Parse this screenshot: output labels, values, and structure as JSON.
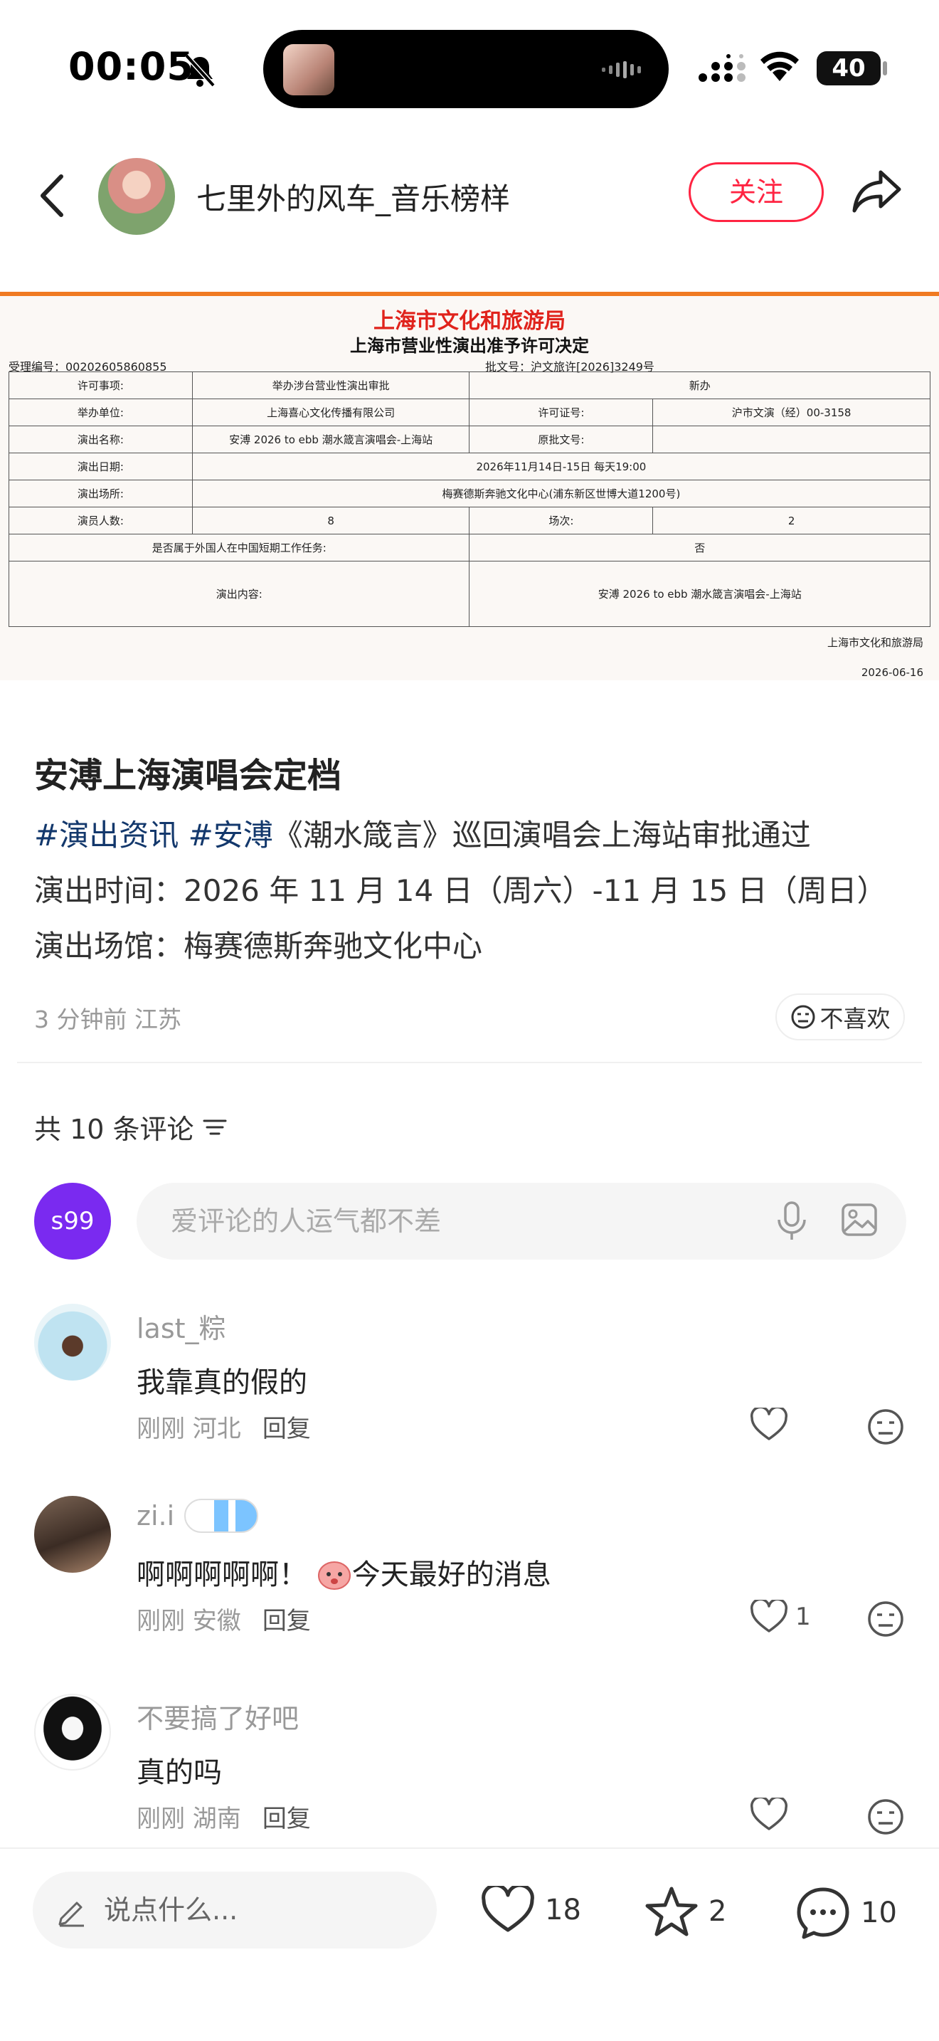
{
  "status_bar": {
    "time": "00:05",
    "battery": "40"
  },
  "header": {
    "author": "七里外的风车_音乐榜样",
    "follow_label": "关注"
  },
  "document": {
    "title_org": "上海市文化和旅游局",
    "title_decision": "上海市营业性演出准予许可决定",
    "receipt_no": "受理编号：00202605860855",
    "approval_no": "批文号：沪文旅许[2026]3249号",
    "rows": {
      "item_label": "许可事项:",
      "item_value": "举办涉台营业性演出审批",
      "item_type": "新办",
      "org_label": "举办单位:",
      "org_value": "上海喜心文化传播有限公司",
      "license_label": "许可证号:",
      "license_value": "沪市文演（经）00-3158",
      "name_label": "演出名称:",
      "name_value": "安溥 2026 to ebb 潮水箴言演唱会-上海站",
      "orig_label": "原批文号:",
      "orig_value": "",
      "date_label": "演出日期:",
      "date_value": "2026年11月14日-15日 每天19:00",
      "venue_label": "演出场所:",
      "venue_value": "梅赛德斯奔驰文化中心(浦东新区世博大道1200号)",
      "actors_label": "演员人数:",
      "actors_value": "8",
      "shows_label": "场次:",
      "shows_value": "2",
      "foreign_label": "是否属于外国人在中国短期工作任务:",
      "foreign_value": "否",
      "content_label": "演出内容:",
      "content_value": "安溥 2026 to ebb 潮水箴言演唱会-上海站"
    },
    "issuer": "上海市文化和旅游局",
    "date": "2026-06-16"
  },
  "post": {
    "title": "安溥上海演唱会定档",
    "tag1": "#演出资讯",
    "tag2": "#安溥",
    "line1_text": "《潮水箴言》巡回演唱会上海站审批通过",
    "line2": "演出时间：2026 年 11 月 14 日（周六）-11 月 15 日（周日）",
    "line3": "演出场馆：梅赛德斯奔驰文化中心",
    "meta": "3 分钟前  江苏",
    "dislike_label": "不喜欢"
  },
  "comments_section": {
    "count_label": "共 10 条评论",
    "my_avatar_text": "s99",
    "input_placeholder": "爱评论的人运气都不差",
    "reply_label": "回复",
    "items": [
      {
        "user": "last_粽",
        "text": "我靠真的假的",
        "time_loc": "刚刚  河北",
        "likes": ""
      },
      {
        "user": "zi.i",
        "text": "啊啊啊啊啊！",
        "text_tail": "今天最好的消息",
        "time_loc": "刚刚  安徽",
        "likes": "1"
      },
      {
        "user": "不要搞了好吧",
        "text": "真的吗",
        "time_loc": "刚刚  湖南",
        "likes": ""
      }
    ]
  },
  "bottom_bar": {
    "say_placeholder": "说点什么...",
    "likes": "18",
    "stars": "2",
    "comments": "10"
  },
  "colors": {
    "accent": "#ff2442",
    "tag": "#13386c",
    "my_avatar": "#7a2af0"
  }
}
